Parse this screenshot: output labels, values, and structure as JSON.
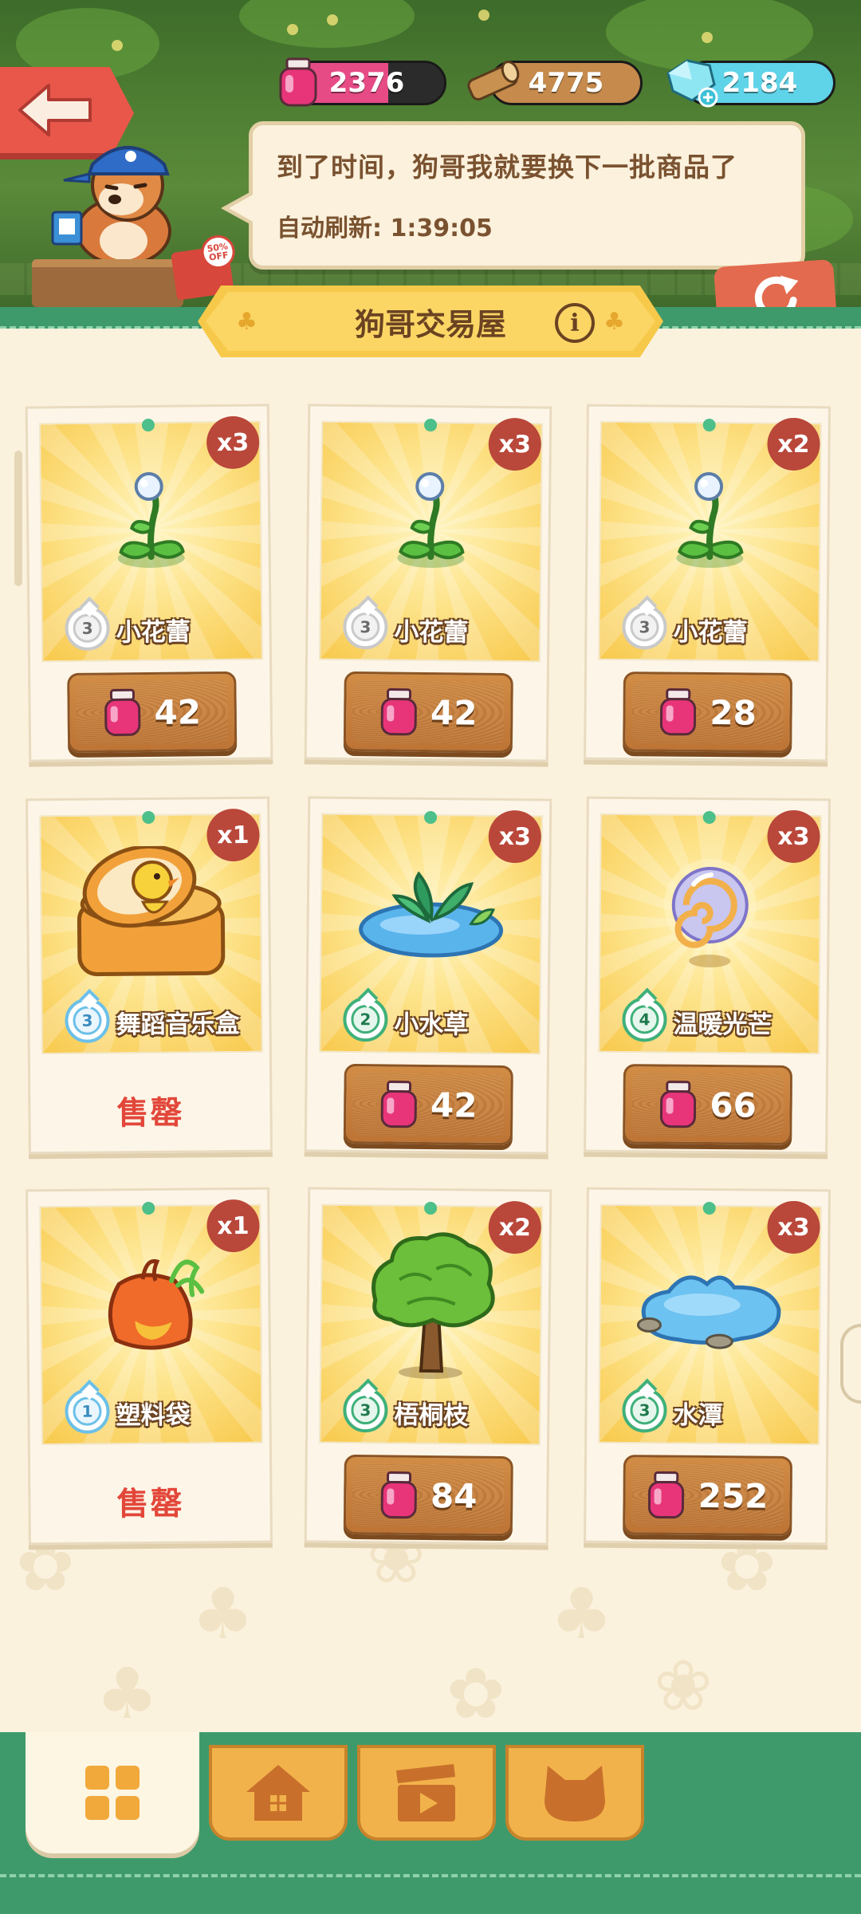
{
  "resources": {
    "potion": "2376",
    "wood": "4775",
    "gem": "2184"
  },
  "dialog": {
    "message": "到了时间，狗哥我就要换下一批商品了",
    "refresh_label": "自动刷新:",
    "refresh_time": "1:39:05"
  },
  "hot_tag": "50% OFF",
  "shop": {
    "title": "狗哥交易屋",
    "info_icon": "i",
    "sold_out_label": "售罄",
    "items": [
      {
        "name": "小花蕾",
        "qty": "x3",
        "level": "3",
        "price": "42",
        "sold_out": false,
        "icon": "flower-bud-icon"
      },
      {
        "name": "小花蕾",
        "qty": "x3",
        "level": "3",
        "price": "42",
        "sold_out": false,
        "icon": "flower-bud-icon"
      },
      {
        "name": "小花蕾",
        "qty": "x2",
        "level": "3",
        "price": "28",
        "sold_out": false,
        "icon": "flower-bud-icon"
      },
      {
        "name": "舞蹈音乐盒",
        "qty": "x1",
        "level": "3",
        "price": "",
        "sold_out": true,
        "icon": "music-box-icon"
      },
      {
        "name": "小水草",
        "qty": "x3",
        "level": "2",
        "price": "42",
        "sold_out": false,
        "icon": "water-grass-icon"
      },
      {
        "name": "温暖光芒",
        "qty": "x3",
        "level": "4",
        "price": "66",
        "sold_out": false,
        "icon": "warm-orb-icon"
      },
      {
        "name": "塑料袋",
        "qty": "x1",
        "level": "1",
        "price": "",
        "sold_out": true,
        "icon": "plastic-bag-icon"
      },
      {
        "name": "梧桐枝",
        "qty": "x2",
        "level": "3",
        "price": "84",
        "sold_out": false,
        "icon": "tree-icon"
      },
      {
        "name": "水潭",
        "qty": "x3",
        "level": "3",
        "price": "252",
        "sold_out": false,
        "icon": "pond-icon"
      }
    ]
  },
  "tabs": [
    {
      "icon": "grid-icon",
      "active": true
    },
    {
      "icon": "house-icon",
      "active": false
    },
    {
      "icon": "video-icon",
      "active": false
    },
    {
      "icon": "cat-icon",
      "active": false
    }
  ],
  "colors": {
    "accent_green": "#3f9a6b",
    "sold_out_red": "#e2473a",
    "quantity_badge": "#b9473a",
    "level_gray": "#c9c9c9",
    "level_blue": "#6cc0e8",
    "level_green": "#3fb07a"
  }
}
